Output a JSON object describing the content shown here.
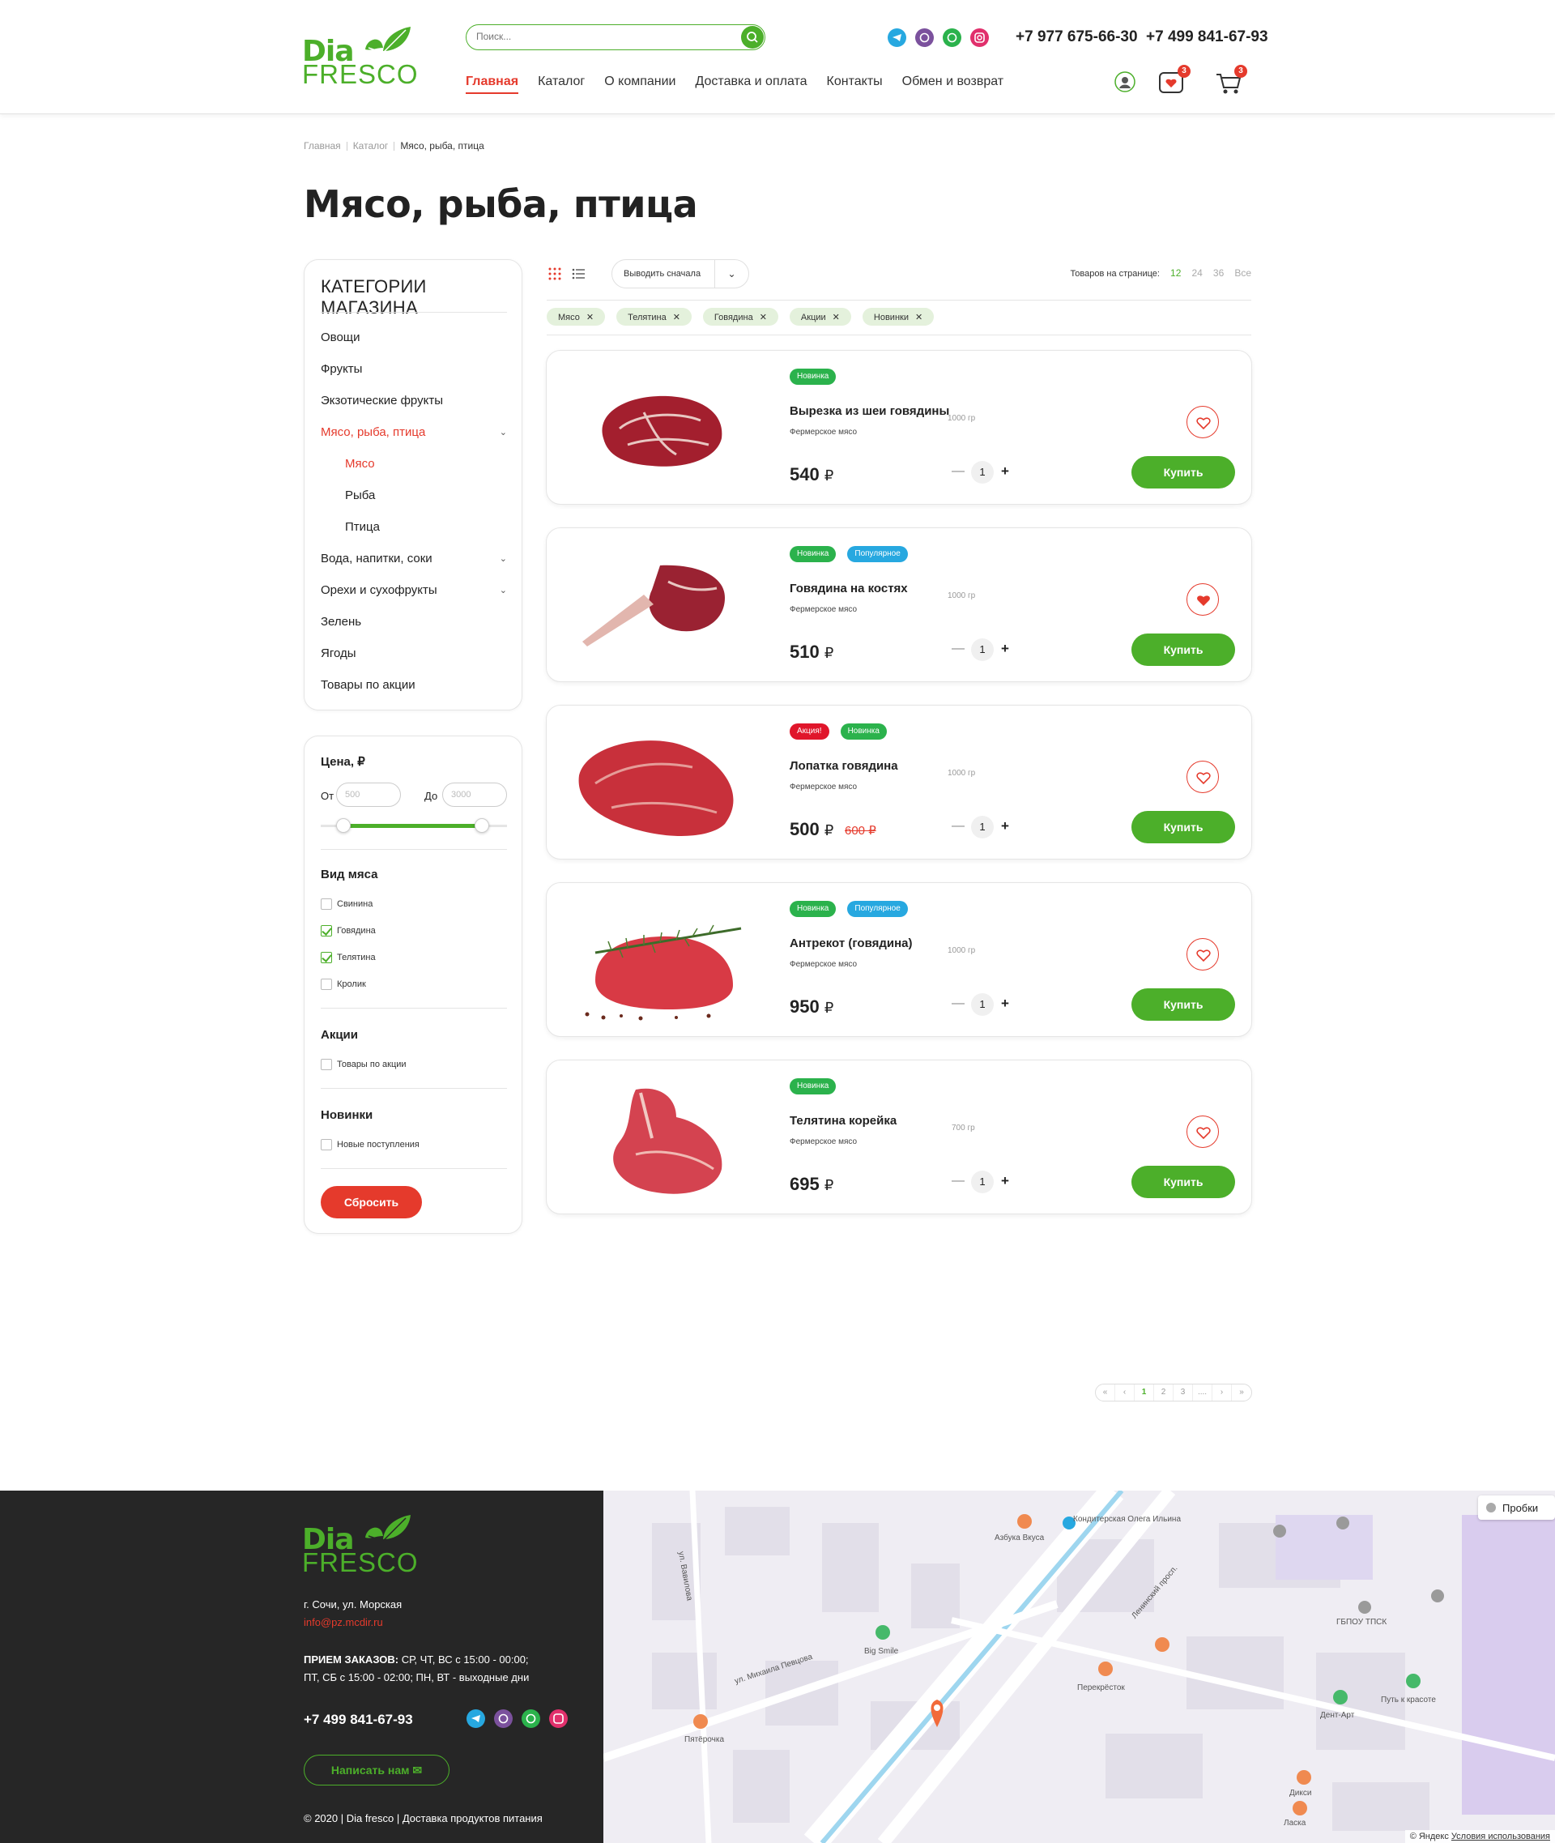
{
  "header": {
    "logo_top": "Dia",
    "logo_bottom": "FRESCO",
    "search_placeholder": "Поиск...",
    "nav": [
      "Главная",
      "Каталог",
      "О компании",
      "Доставка и оплата",
      "Контакты",
      "Обмен и возврат"
    ],
    "phone1": "+7 977 675-66-30",
    "phone2": "+7 499 841-67-93",
    "fav_count": "3",
    "cart_count": "3",
    "social": [
      "telegram-icon",
      "viber-icon",
      "whatsapp-icon",
      "instagram-icon"
    ]
  },
  "breadcrumbs": [
    "Главная",
    "Каталог",
    "Мясо, рыба, птица"
  ],
  "page_title": "Мясо, рыба, птица",
  "sidebar": {
    "title": "КАТЕГОРИИ МАГАЗИНА",
    "items": [
      {
        "label": "Овощи"
      },
      {
        "label": "Фрукты"
      },
      {
        "label": "Экзотические фрукты"
      },
      {
        "label": "Мясо, рыба, птица",
        "active": true,
        "expanded": true
      },
      {
        "label": "Мясо",
        "sub": true,
        "active": true
      },
      {
        "label": "Рыба",
        "sub": true
      },
      {
        "label": "Птица",
        "sub": true
      },
      {
        "label": "Вода, напитки, соки",
        "expandable": true
      },
      {
        "label": "Орехи и сухофрукты",
        "expandable": true
      },
      {
        "label": "Зелень"
      },
      {
        "label": "Ягоды"
      },
      {
        "label": "Товары по акции"
      }
    ]
  },
  "filters": {
    "price_title": "Цена, ₽",
    "from_label": "От",
    "to_label": "До",
    "from_placeholder": "500",
    "to_placeholder": "3000",
    "meat_title": "Вид мяса",
    "meat_options": [
      {
        "label": "Свинина",
        "checked": false
      },
      {
        "label": "Говядина",
        "checked": true
      },
      {
        "label": "Телятина",
        "checked": true
      },
      {
        "label": "Кролик",
        "checked": false
      }
    ],
    "promo_title": "Акции",
    "promo_option": "Товары по акции",
    "new_title": "Новинки",
    "new_option": "Новые поступления",
    "reset": "Сбросить"
  },
  "toolbar": {
    "sort_label": "Выводить сначала",
    "per_page_label": "Товаров на странице:",
    "per_page_options": [
      "12",
      "24",
      "36",
      "Все"
    ],
    "chips": [
      "Мясо",
      "Телятина",
      "Говядина",
      "Акции",
      "Новинки"
    ]
  },
  "products": [
    {
      "name": "Вырезка из шеи говядины",
      "sub": "Фермерское мясо",
      "weight": "1000 гр",
      "price": "540",
      "currency": "₽",
      "old_price": "",
      "tags": [
        {
          "text": "Новинка",
          "kind": "green"
        }
      ],
      "qty": "1",
      "fav": false,
      "buy": "Купить"
    },
    {
      "name": "Говядина на костях",
      "sub": "Фермерское мясо",
      "weight": "1000 гр",
      "price": "510",
      "currency": "₽",
      "old_price": "",
      "tags": [
        {
          "text": "Новинка",
          "kind": "green"
        },
        {
          "text": "Популярное",
          "kind": "blue"
        }
      ],
      "qty": "1",
      "fav": true,
      "buy": "Купить"
    },
    {
      "name": "Лопатка говядина",
      "sub": "Фермерское мясо",
      "weight": "1000 гр",
      "price": "500",
      "currency": "₽",
      "old_price": "600 ₽",
      "tags": [
        {
          "text": "Акция!",
          "kind": "red"
        },
        {
          "text": "Новинка",
          "kind": "green"
        }
      ],
      "qty": "1",
      "fav": false,
      "buy": "Купить"
    },
    {
      "name": "Антрекот (говядина)",
      "sub": "Фермерское мясо",
      "weight": "1000 гр",
      "price": "950",
      "currency": "₽",
      "old_price": "",
      "tags": [
        {
          "text": "Новинка",
          "kind": "green"
        },
        {
          "text": "Популярное",
          "kind": "blue"
        }
      ],
      "qty": "1",
      "fav": false,
      "buy": "Купить"
    },
    {
      "name": "Телятина корейка",
      "sub": "Фермерское мясо",
      "weight": "700 гр",
      "price": "695",
      "currency": "₽",
      "old_price": "",
      "tags": [
        {
          "text": "Новинка",
          "kind": "green"
        }
      ],
      "qty": "1",
      "fav": false,
      "buy": "Купить"
    }
  ],
  "pagination": [
    "«",
    "‹",
    "1",
    "2",
    "3",
    "....",
    "›",
    "»"
  ],
  "footer": {
    "address": "г. Сочи, ул. Морская",
    "email": "info@pz.mcdir.ru",
    "hours_label": "ПРИЕМ ЗАКАЗОВ:",
    "hours1": " СР, ЧТ, ВС с 15:00 - 00:00;",
    "hours2": "ПТ, СБ с 15:00 - 02:00; ПН, ВТ - выходные дни",
    "phone": "+7 499 841-67-93",
    "write_btn": "Написать нам",
    "copyright": "© 2020 | Dia fresco | Доставка продуктов питания"
  },
  "map": {
    "traffic": "Пробки",
    "copyright": "© Яндекс",
    "terms": "Условия использования",
    "labels": [
      "Азбука Вкуса",
      "Кондитерская Олега Ильина",
      "Ленинский просп.",
      "Big Smile",
      "ул. Михаила Певцова",
      "Перекрёсток",
      "Пятёрочка",
      "Дент-Арт",
      "Путь к красоте",
      "ГБПОУ ТПСК",
      "Дикси",
      "Ласка",
      "ул. Вавилова"
    ]
  },
  "colors": {
    "green": "#4caf2a",
    "red": "#e53a2c",
    "blue": "#27a8e0",
    "dark": "#262626"
  }
}
